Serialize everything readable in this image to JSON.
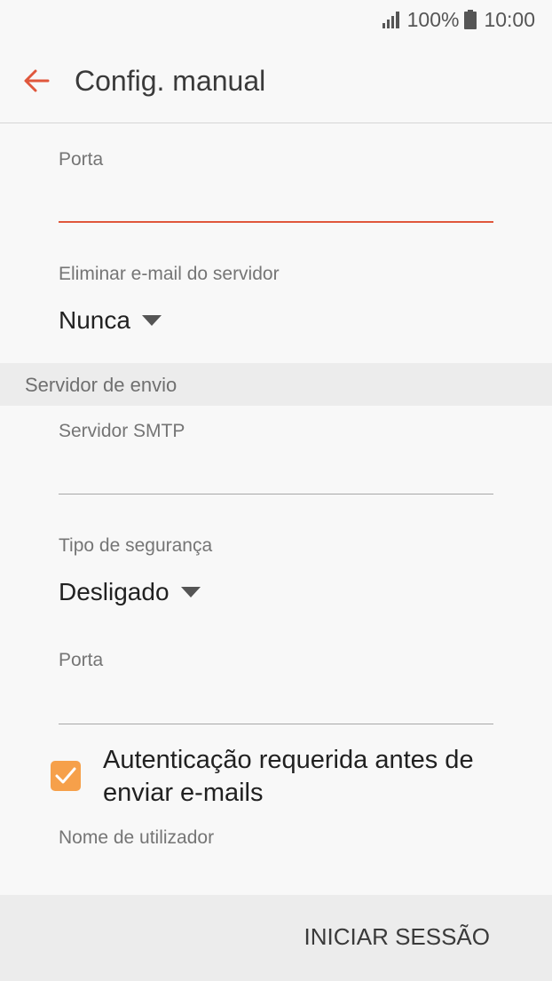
{
  "status_bar": {
    "battery": "100%",
    "time": "10:00",
    "icons": [
      "signal-icon",
      "battery-icon"
    ]
  },
  "app_bar": {
    "title": "Config. manual",
    "back_icon": "arrow-back-icon"
  },
  "incoming": {
    "port": {
      "label": "Porta",
      "value": ""
    },
    "delete_email": {
      "label": "Eliminar e-mail do servidor",
      "value": "Nunca"
    }
  },
  "outgoing": {
    "section_title": "Servidor de envio",
    "smtp_server": {
      "label": "Servidor SMTP",
      "value": ""
    },
    "security_type": {
      "label": "Tipo de segurança",
      "value": "Desligado"
    },
    "port": {
      "label": "Porta",
      "value": ""
    },
    "auth_required": {
      "label": "Autenticação requerida antes de enviar e-mails",
      "checked": true
    },
    "username": {
      "label": "Nome de utilizador"
    }
  },
  "footer": {
    "login_label": "INICIAR SESSÃO"
  },
  "colors": {
    "accent": "#e0573c",
    "checkbox": "#f6a04a",
    "background": "#f8f8f8",
    "section_bg": "#ececec"
  }
}
